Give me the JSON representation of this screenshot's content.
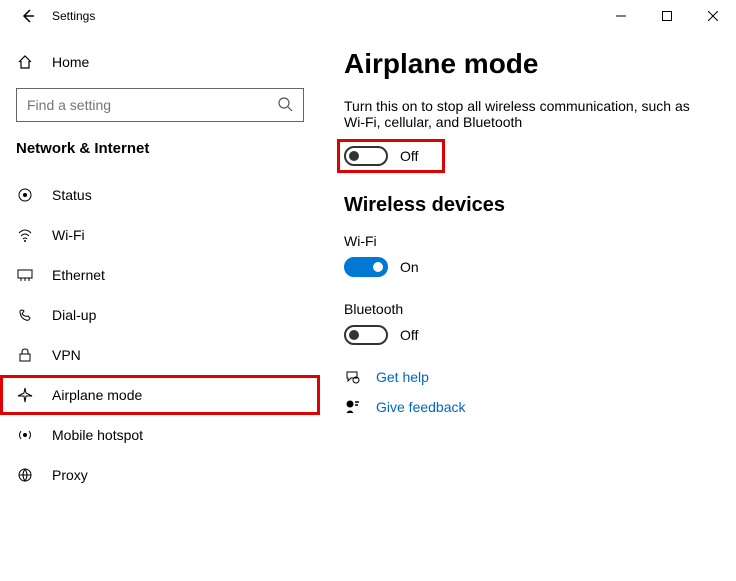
{
  "window": {
    "title": "Settings"
  },
  "sidebar": {
    "home": "Home",
    "search_placeholder": "Find a setting",
    "section": "Network & Internet",
    "items": [
      {
        "label": "Status"
      },
      {
        "label": "Wi-Fi"
      },
      {
        "label": "Ethernet"
      },
      {
        "label": "Dial-up"
      },
      {
        "label": "VPN"
      },
      {
        "label": "Airplane mode"
      },
      {
        "label": "Mobile hotspot"
      },
      {
        "label": "Proxy"
      }
    ]
  },
  "main": {
    "title": "Airplane mode",
    "description": "Turn this on to stop all wireless communication, such as Wi-Fi, cellular, and Bluetooth",
    "airplane_state": "Off",
    "wireless_heading": "Wireless devices",
    "wifi_label": "Wi-Fi",
    "wifi_state": "On",
    "bluetooth_label": "Bluetooth",
    "bluetooth_state": "Off",
    "get_help": "Get help",
    "give_feedback": "Give feedback"
  }
}
